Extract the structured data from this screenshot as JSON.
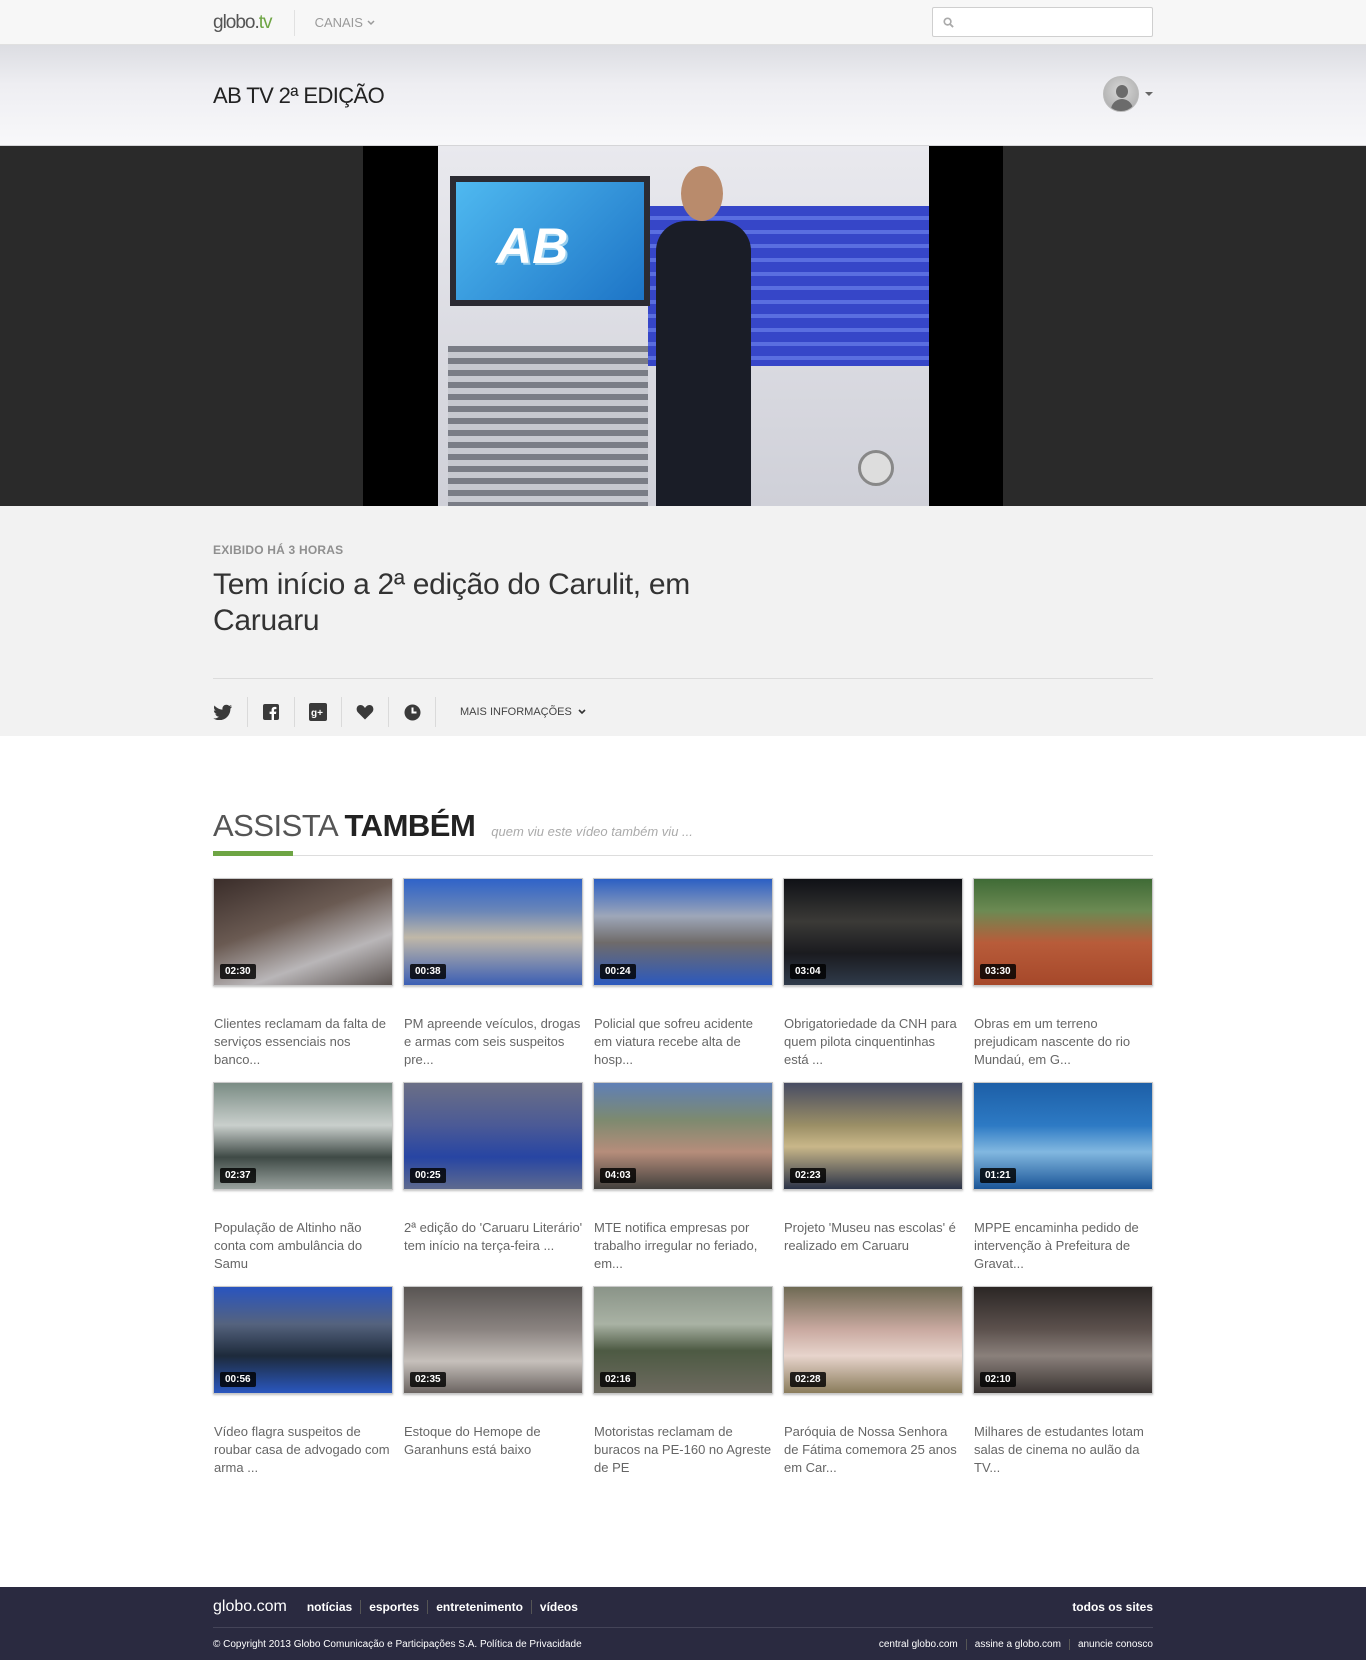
{
  "topbar": {
    "logo_globo": "globo",
    "logo_dot": ".",
    "logo_tv": "tv",
    "canais_label": "CANAIS",
    "search_placeholder": ""
  },
  "program": {
    "title": "AB TV 2ª EDIÇÃO"
  },
  "player": {
    "screen_logo": "AB"
  },
  "video": {
    "aired": "EXIBIDO HÁ 3 HORAS",
    "title": "Tem início a 2ª edição do Carulit, em Caruaru",
    "mais_informacoes": "MAIS INFORMAÇÕES"
  },
  "assista": {
    "title_light": "ASSISTA ",
    "title_bold": "TAMBÉM",
    "subtitle": "quem viu este vídeo também viu ...",
    "accent_color": "#6ea544"
  },
  "videos": [
    {
      "duration": "02:30",
      "caption": "Clientes reclamam da falta de serviços essenciais nos banco..."
    },
    {
      "duration": "00:38",
      "caption": "PM apreende veículos, drogas e armas com seis suspeitos pre..."
    },
    {
      "duration": "00:24",
      "caption": "Policial que sofreu acidente em viatura recebe alta de hosp..."
    },
    {
      "duration": "03:04",
      "caption": "Obrigatoriedade da CNH para quem pilota cinquentinhas está ..."
    },
    {
      "duration": "03:30",
      "caption": "Obras em um terreno prejudicam nascente do rio Mundaú, em G..."
    },
    {
      "duration": "02:37",
      "caption": "População de Altinho não conta com ambulância do Samu"
    },
    {
      "duration": "00:25",
      "caption": "2ª edição do 'Caruaru Literário' tem início na terça-feira ..."
    },
    {
      "duration": "04:03",
      "caption": "MTE notifica empresas por trabalho irregular no feriado, em..."
    },
    {
      "duration": "02:23",
      "caption": "Projeto 'Museu nas escolas' é realizado em Caruaru"
    },
    {
      "duration": "01:21",
      "caption": "MPPE encaminha pedido de intervenção à Prefeitura de Gravat..."
    },
    {
      "duration": "00:56",
      "caption": "Vídeo flagra suspeitos de roubar casa de advogado com arma ..."
    },
    {
      "duration": "02:35",
      "caption": "Estoque do Hemope de Garanhuns está baixo"
    },
    {
      "duration": "02:16",
      "caption": "Motoristas reclamam de buracos na PE-160 no Agreste de PE"
    },
    {
      "duration": "02:28",
      "caption": "Paróquia de Nossa Senhora de Fátima comemora 25 anos em Car..."
    },
    {
      "duration": "02:10",
      "caption": "Milhares de estudantes lotam salas de cinema no aulão da TV..."
    }
  ],
  "footer": {
    "logo": "globo.com",
    "links": [
      "notícias",
      "esportes",
      "entretenimento",
      "vídeos"
    ],
    "todos": "todos os sites",
    "copyright": "© Copyright 2013 Globo Comunicação e Participações S.A. Política de Privacidade",
    "bottom_links": [
      "central globo.com",
      "assine a globo.com",
      "anuncie conosco"
    ]
  }
}
